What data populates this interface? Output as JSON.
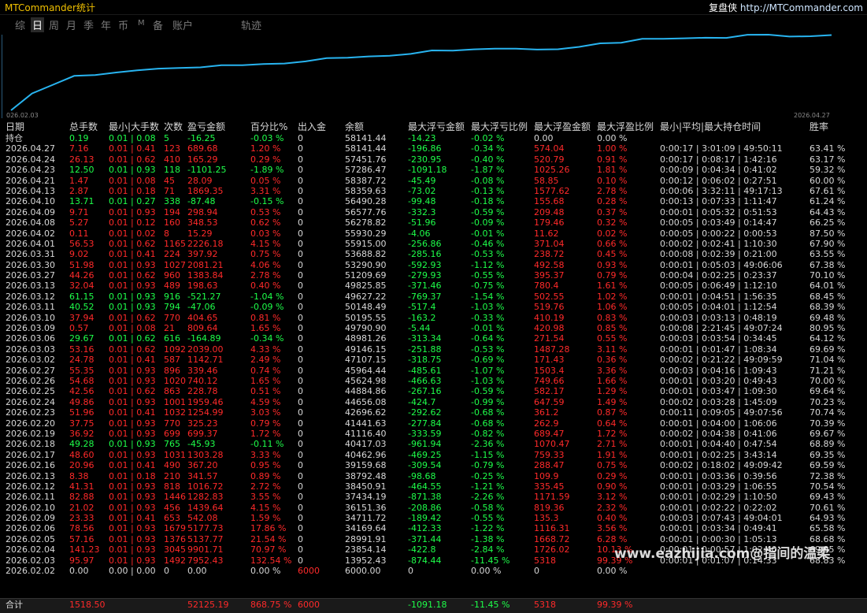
{
  "title": "MTCommander统计",
  "brand": {
    "name": "复盘侠",
    "url": "http://MTCommander.com"
  },
  "tabs": [
    "综",
    "日",
    "周",
    "月",
    "季",
    "年",
    "币",
    "M",
    "备",
    "账户",
    "轨迹"
  ],
  "active_tab": "日",
  "chart": {
    "start_label": "026.02.03",
    "end_label": "2026.04.27",
    "points": [
      [
        0,
        13952.43
      ],
      [
        1,
        23854.14
      ],
      [
        2,
        28991.91
      ],
      [
        3,
        34169.64
      ],
      [
        4,
        34711.72
      ],
      [
        5,
        36151.36
      ],
      [
        6,
        37434.19
      ],
      [
        7,
        38450.91
      ],
      [
        8,
        38792.48
      ],
      [
        9,
        39159.68
      ],
      [
        10,
        40462.96
      ],
      [
        11,
        40417.03
      ],
      [
        12,
        41116.4
      ],
      [
        13,
        41441.63
      ],
      [
        14,
        42696.62
      ],
      [
        15,
        44656.08
      ],
      [
        16,
        44884.86
      ],
      [
        17,
        45624.98
      ],
      [
        18,
        45964.44
      ],
      [
        19,
        47107.15
      ],
      [
        20,
        49146.15
      ],
      [
        21,
        48981.26
      ],
      [
        22,
        49790.9
      ],
      [
        23,
        50195.55
      ],
      [
        24,
        50148.49
      ],
      [
        25,
        49627.22
      ],
      [
        26,
        49825.85
      ],
      [
        27,
        51209.69
      ],
      [
        28,
        53290.9
      ],
      [
        29,
        53688.82
      ],
      [
        30,
        55915.0
      ],
      [
        31,
        55930.29
      ],
      [
        32,
        56278.82
      ],
      [
        33,
        56577.76
      ],
      [
        34,
        56490.28
      ],
      [
        35,
        58359.63
      ],
      [
        36,
        58387.72
      ],
      [
        37,
        57286.47
      ],
      [
        38,
        57451.76
      ],
      [
        39,
        58141.44
      ]
    ]
  },
  "headers": [
    "日期",
    "总手数",
    "最小|大手数",
    "次数",
    "盈亏金额",
    "百分比%",
    "出入金",
    "余额",
    "最大浮亏金额",
    "最大浮亏比例",
    "最大浮盈金额",
    "最大浮盈比例",
    "最小|平均|最大持仓时间",
    "胜率"
  ],
  "holding": [
    "持仓",
    "0.19",
    "0.01 | 0.08",
    "5",
    "-16.25",
    "-0.03 %",
    "0",
    "58141.44",
    "-14.23",
    "-0.02 %",
    "0.00",
    "0.00 %",
    "",
    ""
  ],
  "rows": [
    [
      "2026.04.27",
      "7.16",
      "0.01 | 0.41",
      "123",
      "689.68",
      "1.20 %",
      "0",
      "58141.44",
      "-196.86",
      "-0.34 %",
      "574.04",
      "1.00 %",
      "0:00:17 | 3:01:09 | 49:50:11",
      "63.41 %"
    ],
    [
      "2026.04.24",
      "26.13",
      "0.01 | 0.62",
      "410",
      "165.29",
      "0.29 %",
      "0",
      "57451.76",
      "-230.95",
      "-0.40 %",
      "520.79",
      "0.91 %",
      "0:00:17 | 0:08:17 | 1:42:16",
      "63.17 %"
    ],
    [
      "2026.04.23",
      "12.50",
      "0.01 | 0.93",
      "118",
      "-1101.25",
      "-1.89 %",
      "0",
      "57286.47",
      "-1091.18",
      "-1.87 %",
      "1025.26",
      "1.81 %",
      "0:00:09 | 0:04:34 | 0:41:02",
      "59.32 %"
    ],
    [
      "2026.04.21",
      "1.47",
      "0.01 | 0.08",
      "45",
      "28.09",
      "0.05 %",
      "0",
      "58387.72",
      "-45.49",
      "-0.08 %",
      "58.85",
      "0.10 %",
      "0:00:12 | 0:06:02 | 0:27:51",
      "60.00 %"
    ],
    [
      "2026.04.13",
      "2.87",
      "0.01 | 0.18",
      "71",
      "1869.35",
      "3.31 %",
      "0",
      "58359.63",
      "-73.02",
      "-0.13 %",
      "1577.62",
      "2.78 %",
      "0:00:06 | 3:32:11 | 49:17:13",
      "67.61 %"
    ],
    [
      "2026.04.10",
      "13.71",
      "0.01 | 0.27",
      "338",
      "-87.48",
      "-0.15 %",
      "0",
      "56490.28",
      "-99.48",
      "-0.18 %",
      "155.68",
      "0.28 %",
      "0:00:13 | 0:07:33 | 1:11:47",
      "61.24 %"
    ],
    [
      "2026.04.09",
      "9.71",
      "0.01 | 0.93",
      "194",
      "298.94",
      "0.53 %",
      "0",
      "56577.76",
      "-332.3",
      "-0.59 %",
      "209.48",
      "0.37 %",
      "0:00:01 | 0:05:32 | 0:51:53",
      "64.43 %"
    ],
    [
      "2026.04.08",
      "5.27",
      "0.01 | 0.12",
      "160",
      "348.53",
      "0.62 %",
      "0",
      "56278.82",
      "-51.96",
      "-0.09 %",
      "179.46",
      "0.32 %",
      "0:00:05 | 0:03:49 | 0:14:47",
      "66.25 %"
    ],
    [
      "2026.04.02",
      "0.11",
      "0.01 | 0.02",
      "8",
      "15.29",
      "0.03 %",
      "0",
      "55930.29",
      "-4.06",
      "-0.01 %",
      "11.62",
      "0.02 %",
      "0:00:05 | 0:00:22 | 0:00:53",
      "87.50 %"
    ],
    [
      "2026.04.01",
      "56.53",
      "0.01 | 0.62",
      "1165",
      "2226.18",
      "4.15 %",
      "0",
      "55915.00",
      "-256.86",
      "-0.46 %",
      "371.04",
      "0.66 %",
      "0:00:02 | 0:02:41 | 1:10:30",
      "67.90 %"
    ],
    [
      "2026.03.31",
      "9.02",
      "0.01 | 0.41",
      "224",
      "397.92",
      "0.75 %",
      "0",
      "53688.82",
      "-285.16",
      "-0.53 %",
      "238.72",
      "0.45 %",
      "0:00:08 | 0:02:39 | 0:21:00",
      "63.55 %"
    ],
    [
      "2026.03.30",
      "51.98",
      "0.01 | 0.93",
      "1027",
      "2081.21",
      "4.06 %",
      "0",
      "53290.90",
      "-592.93",
      "-1.12 %",
      "492.58",
      "0.93 %",
      "0:00:01 | 0:05:03 | 49:06:06",
      "67.38 %"
    ],
    [
      "2026.03.27",
      "44.26",
      "0.01 | 0.62",
      "960",
      "1383.84",
      "2.78 %",
      "0",
      "51209.69",
      "-279.93",
      "-0.55 %",
      "395.37",
      "0.79 %",
      "0:00:04 | 0:02:25 | 0:23:37",
      "70.10 %"
    ],
    [
      "2026.03.13",
      "32.04",
      "0.01 | 0.93",
      "489",
      "198.63",
      "0.40 %",
      "0",
      "49825.85",
      "-371.46",
      "-0.75 %",
      "780.4",
      "1.61 %",
      "0:00:05 | 0:06:49 | 1:12:10",
      "64.01 %"
    ],
    [
      "2026.03.12",
      "61.15",
      "0.01 | 0.93",
      "916",
      "-521.27",
      "-1.04 %",
      "0",
      "49627.22",
      "-769.37",
      "-1.54 %",
      "502.55",
      "1.02 %",
      "0:00:01 | 0:04:51 | 1:56:35",
      "68.45 %"
    ],
    [
      "2026.03.11",
      "40.52",
      "0.01 | 0.93",
      "794",
      "-47.06",
      "-0.09 %",
      "0",
      "50148.49",
      "-517.4",
      "-1.03 %",
      "519.76",
      "1.06 %",
      "0:00:05 | 0:04:01 | 1:12:54",
      "68.39 %"
    ],
    [
      "2026.03.10",
      "37.94",
      "0.01 | 0.62",
      "770",
      "404.65",
      "0.81 %",
      "0",
      "50195.55",
      "-163.2",
      "-0.33 %",
      "410.19",
      "0.83 %",
      "0:00:03 | 0:03:13 | 0:48:19",
      "69.48 %"
    ],
    [
      "2026.03.09",
      "0.57",
      "0.01 | 0.08",
      "21",
      "809.64",
      "1.65 %",
      "0",
      "49790.90",
      "-5.44",
      "-0.01 %",
      "420.98",
      "0.85 %",
      "0:00:08 | 2:21:45 | 49:07:24",
      "80.95 %"
    ],
    [
      "2026.03.06",
      "29.67",
      "0.01 | 0.62",
      "616",
      "-164.89",
      "-0.34 %",
      "0",
      "48981.26",
      "-313.34",
      "-0.64 %",
      "271.54",
      "0.55 %",
      "0:00:03 | 0:03:54 | 0:34:45",
      "64.12 %"
    ],
    [
      "2026.03.03",
      "53.16",
      "0.01 | 0.62",
      "1092",
      "2039.00",
      "4.33 %",
      "0",
      "49146.15",
      "-251.88",
      "-0.53 %",
      "1487.28",
      "3.11 %",
      "0:00:01 | 0:01:47 | 1:08:34",
      "69.69 %"
    ],
    [
      "2026.03.02",
      "24.78",
      "0.01 | 0.41",
      "587",
      "1142.71",
      "2.49 %",
      "0",
      "47107.15",
      "-318.75",
      "-0.69 %",
      "171.43",
      "0.36 %",
      "0:00:02 | 0:21:22 | 49:09:59",
      "71.04 %"
    ],
    [
      "2026.02.27",
      "55.35",
      "0.01 | 0.93",
      "896",
      "339.46",
      "0.74 %",
      "0",
      "45964.44",
      "-485.61",
      "-1.07 %",
      "1503.4",
      "3.36 %",
      "0:00:03 | 0:04:16 | 1:09:43",
      "71.21 %"
    ],
    [
      "2026.02.26",
      "54.68",
      "0.01 | 0.93",
      "1020",
      "740.12",
      "1.65 %",
      "0",
      "45624.98",
      "-466.63",
      "-1.03 %",
      "749.66",
      "1.66 %",
      "0:00:01 | 0:03:20 | 0:49:43",
      "70.00 %"
    ],
    [
      "2026.02.25",
      "42.56",
      "0.01 | 0.62",
      "863",
      "228.78",
      "0.51 %",
      "0",
      "44884.86",
      "-267.16",
      "-0.59 %",
      "582.17",
      "1.29 %",
      "0:00:01 | 0:03:47 | 1:09:30",
      "69.64 %"
    ],
    [
      "2026.02.24",
      "49.86",
      "0.01 | 0.93",
      "1001",
      "1959.46",
      "4.59 %",
      "0",
      "44656.08",
      "-424.7",
      "-0.99 %",
      "647.59",
      "1.49 %",
      "0:00:02 | 0:03:28 | 1:45:09",
      "70.23 %"
    ],
    [
      "2026.02.23",
      "51.96",
      "0.01 | 0.41",
      "1032",
      "1254.99",
      "3.03 %",
      "0",
      "42696.62",
      "-292.62",
      "-0.68 %",
      "361.2",
      "0.87 %",
      "0:00:11 | 0:09:05 | 49:07:56",
      "70.74 %"
    ],
    [
      "2026.02.20",
      "37.75",
      "0.01 | 0.93",
      "770",
      "325.23",
      "0.79 %",
      "0",
      "41441.63",
      "-277.84",
      "-0.68 %",
      "262.9",
      "0.64 %",
      "0:00:01 | 0:04:00 | 1:06:06",
      "70.39 %"
    ],
    [
      "2026.02.19",
      "36.92",
      "0.01 | 0.93",
      "699",
      "699.37",
      "1.72 %",
      "0",
      "41116.40",
      "-333.59",
      "-0.82 %",
      "689.47",
      "1.72 %",
      "0:00:02 | 0:04:38 | 0:41:06",
      "69.67 %"
    ],
    [
      "2026.02.18",
      "49.28",
      "0.01 | 0.93",
      "765",
      "-45.93",
      "-0.11 %",
      "0",
      "40417.03",
      "-961.94",
      "-2.36 %",
      "1070.47",
      "2.71 %",
      "0:00:01 | 0:04:40 | 0:47:54",
      "68.89 %"
    ],
    [
      "2026.02.17",
      "48.60",
      "0.01 | 0.93",
      "1031",
      "1303.28",
      "3.33 %",
      "0",
      "40462.96",
      "-469.25",
      "-1.15 %",
      "759.33",
      "1.91 %",
      "0:00:01 | 0:02:25 | 3:43:14",
      "69.35 %"
    ],
    [
      "2026.02.16",
      "20.96",
      "0.01 | 0.41",
      "490",
      "367.20",
      "0.95 %",
      "0",
      "39159.68",
      "-309.54",
      "-0.79 %",
      "288.47",
      "0.75 %",
      "0:00:02 | 0:18:02 | 49:09:42",
      "69.59 %"
    ],
    [
      "2026.02.13",
      "8.38",
      "0.01 | 0.18",
      "210",
      "341.57",
      "0.89 %",
      "0",
      "38792.48",
      "-98.68",
      "-0.25 %",
      "109.9",
      "0.29 %",
      "0:00:01 | 0:03:36 | 0:39:56",
      "72.38 %"
    ],
    [
      "2026.02.12",
      "41.31",
      "0.01 | 0.93",
      "818",
      "1016.72",
      "2.72 %",
      "0",
      "38450.91",
      "-464.55",
      "-1.21 %",
      "335.45",
      "0.90 %",
      "0:00:01 | 0:03:29 | 1:06:55",
      "70.54 %"
    ],
    [
      "2026.02.11",
      "82.88",
      "0.01 | 0.93",
      "1446",
      "1282.83",
      "3.55 %",
      "0",
      "37434.19",
      "-871.38",
      "-2.26 %",
      "1171.59",
      "3.12 %",
      "0:00:01 | 0:02:29 | 1:10:50",
      "69.43 %"
    ],
    [
      "2026.02.10",
      "21.02",
      "0.01 | 0.93",
      "456",
      "1439.64",
      "4.15 %",
      "0",
      "36151.36",
      "-208.86",
      "-0.58 %",
      "819.36",
      "2.32 %",
      "0:00:01 | 0:02:22 | 0:22:02",
      "70.61 %"
    ],
    [
      "2026.02.09",
      "23.33",
      "0.01 | 0.41",
      "653",
      "542.08",
      "1.59 %",
      "0",
      "34711.72",
      "-189.42",
      "-0.55 %",
      "135.3",
      "0.40 %",
      "0:00:03 | 0:07:43 | 49:04:01",
      "64.93 %"
    ],
    [
      "2026.02.06",
      "78.56",
      "0.01 | 0.93",
      "1679",
      "5177.73",
      "17.86 %",
      "0",
      "34169.64",
      "-412.33",
      "-1.22 %",
      "1116.31",
      "3.56 %",
      "0:00:01 | 0:03:34 | 0:49:41",
      "65.58 %"
    ],
    [
      "2026.02.05",
      "57.16",
      "0.01 | 0.93",
      "1376",
      "5137.77",
      "21.54 %",
      "0",
      "28991.91",
      "-371.44",
      "-1.38 %",
      "1668.72",
      "6.28 %",
      "0:00:01 | 0:00:30 | 1:05:13",
      "68.68 %"
    ],
    [
      "2026.02.04",
      "141.23",
      "0.01 | 0.93",
      "3045",
      "9901.71",
      "70.97 %",
      "0",
      "23854.14",
      "-422.8",
      "-2.84 %",
      "1726.02",
      "10.13 %",
      "0:00:01 | 0:00:57 | 1:02:40",
      "69.95 %"
    ],
    [
      "2026.02.03",
      "95.97",
      "0.01 | 0.93",
      "1492",
      "7952.43",
      "132.54 %",
      "0",
      "13952.43",
      "-874.44",
      "-11.45 %",
      "5318",
      "99.39 %",
      "0:00:01 | 0:01:07 | 0:14:33",
      "68.83 %"
    ],
    [
      "2026.02.02",
      "0.00",
      "0.00 | 0.00",
      "0",
      "0.00",
      "0.00 %",
      "6000",
      "6000.00",
      "0",
      "0.00 %",
      "0",
      "0.00 %",
      "",
      ""
    ]
  ],
  "summary": [
    "合计",
    "1518.50",
    "",
    "",
    "52125.19",
    "868.75 %",
    "6000",
    "",
    "-1091.18",
    "-11.45 %",
    "5318",
    "99.39 %",
    "",
    ""
  ],
  "watermark": "www.eazhijia.com@指间的温柔",
  "colors": {
    "profit": "#ff2a2a",
    "loss": "#1eff4a",
    "curve": "#28b4f0",
    "title": "#f0c000"
  }
}
